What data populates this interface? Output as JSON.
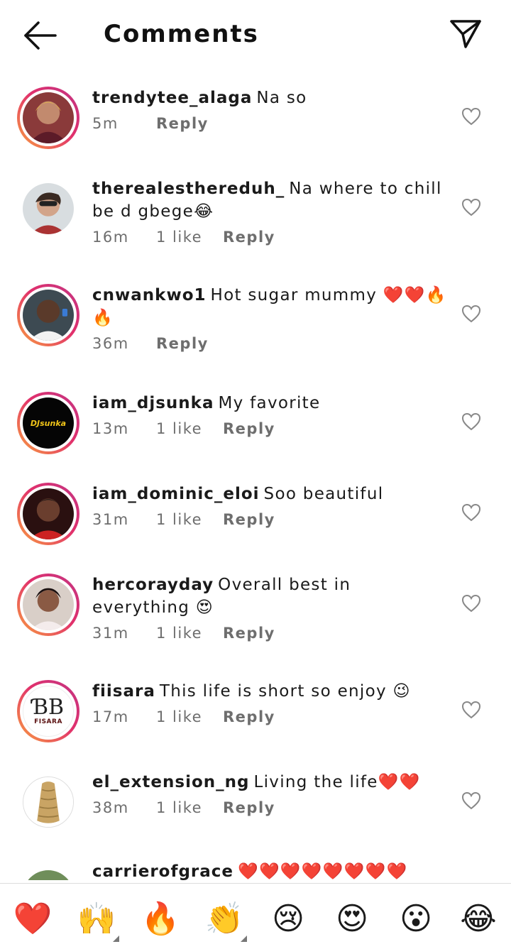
{
  "header": {
    "title": "Comments",
    "back_icon": "arrow-left-icon",
    "send_icon": "paper-plane-icon"
  },
  "comments": [
    {
      "username": "trendytee_alaga",
      "text": "Na so",
      "time": "5m",
      "likes": "",
      "reply": "Reply"
    },
    {
      "username": "therealesthereduh_",
      "text": "Na where to chill be d gbege😂",
      "time": "16m",
      "likes": "1 like",
      "reply": "Reply"
    },
    {
      "username": "cnwankwo1",
      "text": "Hot sugar mummy ❤️❤️🔥🔥",
      "time": "36m",
      "likes": "",
      "reply": "Reply"
    },
    {
      "username": "iam_djsunka",
      "text": "My favorite",
      "time": "13m",
      "likes": "1 like",
      "reply": "Reply",
      "avatar_text": "DJsunka"
    },
    {
      "username": "iam_dominic_eloi",
      "text": "Soo beautiful",
      "time": "31m",
      "likes": "1 like",
      "reply": "Reply"
    },
    {
      "username": "hercorayday",
      "text": "Overall best in everything 😍",
      "time": "31m",
      "likes": "1 like",
      "reply": "Reply"
    },
    {
      "username": "fiisara",
      "text": "This life is short so enjoy 😉",
      "time": "17m",
      "likes": "1 like",
      "reply": "Reply",
      "avatar_text": "FISARA"
    },
    {
      "username": "el_extension_ng",
      "text": "Living the life❤️❤️",
      "time": "38m",
      "likes": "1 like",
      "reply": "Reply"
    },
    {
      "username": "carrierofgrace",
      "text": "❤️❤️❤️❤️❤️❤️❤️❤️",
      "time": "",
      "likes": "",
      "reply": ""
    }
  ],
  "emoji_bar": [
    {
      "emoji": "❤️",
      "name": "red-heart"
    },
    {
      "emoji": "🙌",
      "name": "raising-hands"
    },
    {
      "emoji": "🔥",
      "name": "fire"
    },
    {
      "emoji": "👏",
      "name": "clapping-hands"
    },
    {
      "emoji": "😢",
      "name": "crying-face"
    },
    {
      "emoji": "😍",
      "name": "heart-eyes"
    },
    {
      "emoji": "😮",
      "name": "surprised-face"
    },
    {
      "emoji": "😂",
      "name": "tears-of-joy"
    }
  ]
}
